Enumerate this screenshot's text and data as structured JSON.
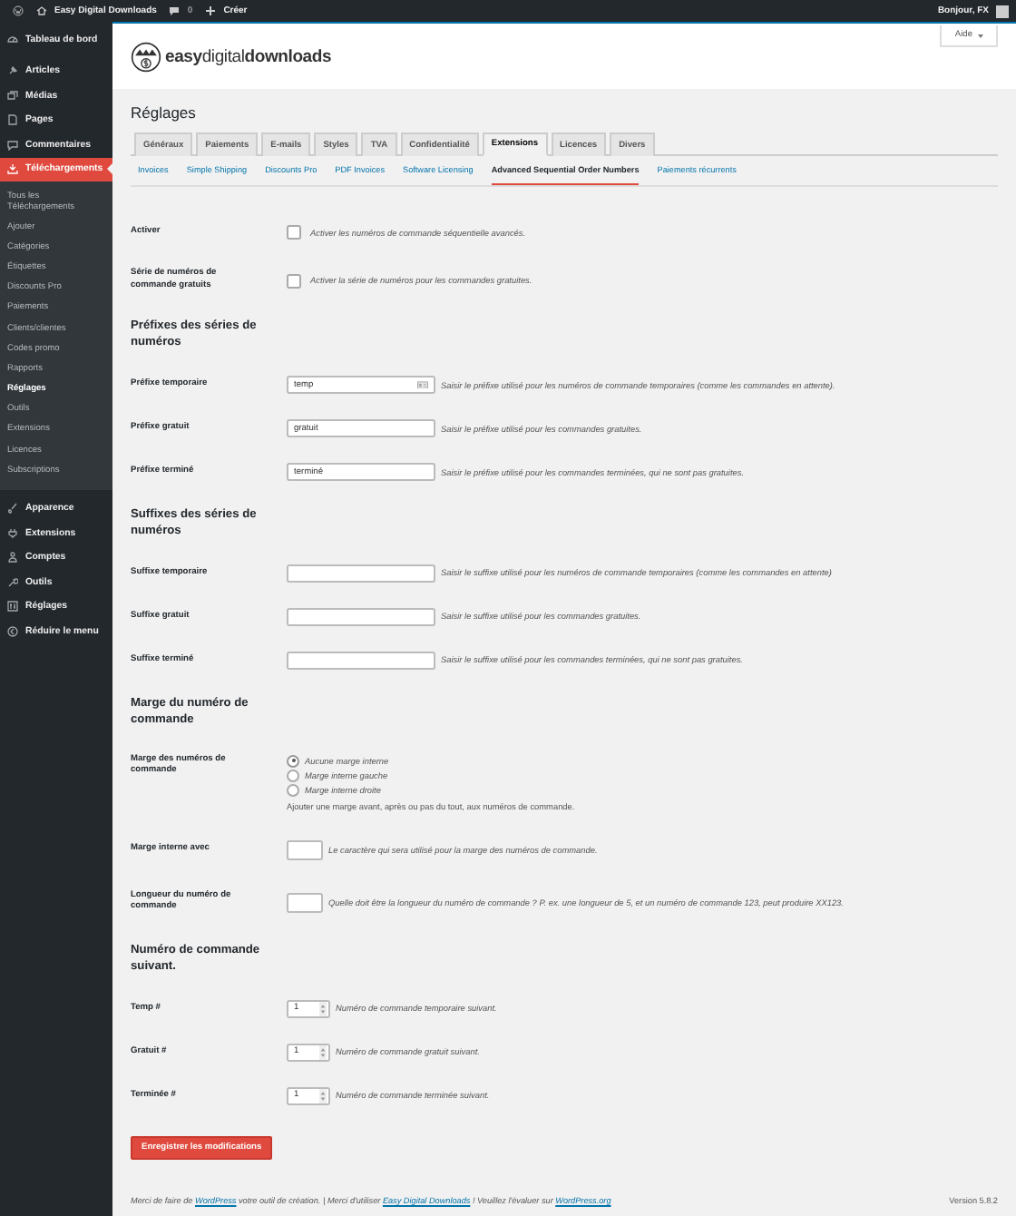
{
  "admin_bar": {
    "site": "Easy Digital Downloads",
    "comments": "0",
    "new": "Créer",
    "greeting": "Bonjour, FX"
  },
  "sidebar": {
    "items": [
      {
        "label": "Tableau de bord",
        "selected": false
      },
      {
        "label": "Articles",
        "selected": false
      },
      {
        "label": "Médias",
        "selected": false
      },
      {
        "label": "Pages",
        "selected": false
      },
      {
        "label": "Commentaires",
        "selected": false
      },
      {
        "label": "Téléchargements",
        "selected": true,
        "children": [
          {
            "label": "Tous les Téléchargements",
            "selected": false
          },
          {
            "label": "Ajouter",
            "selected": false
          },
          {
            "label": "Catégories",
            "selected": false
          },
          {
            "label": "Étiquettes",
            "selected": false
          },
          {
            "label": "Discounts Pro",
            "selected": false
          },
          {
            "label": "Paiements",
            "selected": false
          },
          {
            "label": "Clients/clientes",
            "selected": false
          },
          {
            "label": "Codes promo",
            "selected": false
          },
          {
            "label": "Rapports",
            "selected": false
          },
          {
            "label": "Réglages",
            "selected": true
          },
          {
            "label": "Outils",
            "selected": false
          },
          {
            "label": "Extensions",
            "selected": false
          },
          {
            "label": "Licences",
            "selected": false
          },
          {
            "label": "Subscriptions",
            "selected": false
          }
        ]
      },
      {
        "label": "Apparence",
        "selected": false
      },
      {
        "label": "Extensions",
        "selected": false
      },
      {
        "label": "Comptes",
        "selected": false
      },
      {
        "label": "Outils",
        "selected": false
      },
      {
        "label": "Réglages",
        "selected": false
      },
      {
        "label": "Réduire le menu",
        "selected": false
      }
    ]
  },
  "header": {
    "logo": "**easy**digital**downloads**",
    "help": "Aide"
  },
  "title": "Réglages",
  "tabs": [
    {
      "label": "Généraux",
      "selected": false
    },
    {
      "label": "Paiements",
      "selected": false
    },
    {
      "label": "E-mails",
      "selected": false
    },
    {
      "label": "Styles",
      "selected": false
    },
    {
      "label": "TVA",
      "selected": false
    },
    {
      "label": "Confidentialité",
      "selected": false
    },
    {
      "label": "Extensions",
      "selected": true
    },
    {
      "label": "Licences",
      "selected": false
    },
    {
      "label": "Divers",
      "selected": false
    }
  ],
  "subtabs": [
    {
      "label": "Invoices",
      "selected": false
    },
    {
      "label": "Simple Shipping",
      "selected": false
    },
    {
      "label": "Discounts Pro",
      "selected": false
    },
    {
      "label": "PDF Invoices",
      "selected": false
    },
    {
      "label": "Software Licensing",
      "selected": false
    },
    {
      "label": "Advanced Sequential Order Numbers",
      "selected": true
    },
    {
      "label": "Paiements récurrents",
      "selected": false
    }
  ],
  "rows": [
    {
      "kind": "checkbox",
      "label": "Activer",
      "checked": false,
      "description": "Activer les numéros de commande séquentielle avancés."
    },
    {
      "kind": "checkbox",
      "label": "Série de numéros de commande gratuits",
      "checked": false,
      "description": "Activer la série de numéros pour les commandes gratuites."
    },
    {
      "kind": "heading",
      "label": "Préfixes des séries de numéros"
    },
    {
      "kind": "text",
      "label": "Préfixe temporaire",
      "value": "temp",
      "autofill": true,
      "description": "Saisir le préfixe utilisé pour les numéros de commande temporaires (comme les commandes en attente)."
    },
    {
      "kind": "text",
      "label": "Préfixe gratuit",
      "value": "gratuit",
      "autofill": false,
      "description": "Saisir le préfixe utilisé pour les commandes gratuites."
    },
    {
      "kind": "text",
      "label": "Préfixe terminé",
      "value": "terminé",
      "autofill": false,
      "description": "Saisir le préfixe utilisé pour les commandes terminées, qui ne sont pas gratuites."
    },
    {
      "kind": "heading",
      "label": "Suffixes des séries de numéros"
    },
    {
      "kind": "text",
      "label": "Suffixe temporaire",
      "autofill": false,
      "description": "Saisir le suffixe utilisé pour les numéros de commande temporaires (comme les commandes en attente)"
    },
    {
      "kind": "text",
      "label": "Suffixe gratuit",
      "autofill": false,
      "description": "Saisir le suffixe utilisé pour les commandes gratuites."
    },
    {
      "kind": "text",
      "label": "Suffixe terminé",
      "autofill": false,
      "description": "Saisir le suffixe utilisé pour les commandes terminées, qui ne sont pas gratuites."
    },
    {
      "kind": "heading",
      "label": "Marge du numéro de commande"
    },
    {
      "kind": "radio",
      "label": "Marge des numéros de commande",
      "options": [
        {
          "label": "Aucune marge interne",
          "selected": true
        },
        {
          "label": "Marge interne gauche",
          "selected": false
        },
        {
          "label": "Marge interne droite",
          "selected": false
        }
      ],
      "description": "Ajouter une marge avant, après ou pas du tout, aux numéros de commande."
    },
    {
      "kind": "short",
      "label": "Marge interne avec",
      "description": "Le caractère qui sera utilisé pour la marge des numéros de commande."
    },
    {
      "kind": "short",
      "label": "Longueur du numéro de commande",
      "description": "Quelle doit être la longueur du numéro de commande ? P. ex. une longueur de 5, et un numéro de commande 123, peut produire XX123."
    },
    {
      "kind": "heading",
      "label": "Numéro de commande suivant."
    },
    {
      "kind": "number",
      "label": "Temp #",
      "value": "1",
      "description": "Numéro de commande temporaire suivant."
    },
    {
      "kind": "number",
      "label": "Gratuit #",
      "value": "1",
      "description": "Numéro de commande gratuit suivant."
    },
    {
      "kind": "number",
      "label": "Terminée #",
      "value": "1",
      "description": "Numéro de commande terminée suivant."
    }
  ],
  "save_button": "Enregistrer les modifications",
  "footer": {
    "parts": [
      {
        "text": "Merci de faire de ",
        "link": false
      },
      {
        "text": "WordPress",
        "link": true
      },
      {
        "text": " votre outil de création. | Merci d'utiliser ",
        "link": false
      },
      {
        "text": "Easy Digital Downloads",
        "link": true
      },
      {
        "text": " ! Veuillez l'évaluer sur ",
        "link": false
      },
      {
        "text": "WordPress.org",
        "link": true
      }
    ],
    "version": "Version 5.8.2"
  }
}
